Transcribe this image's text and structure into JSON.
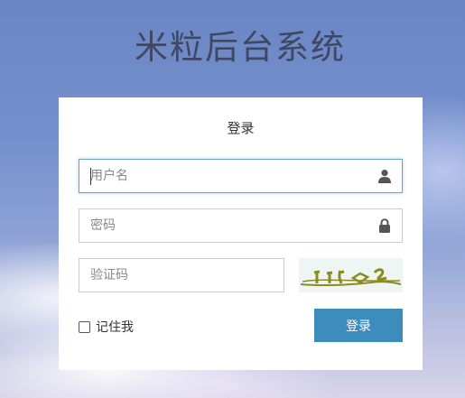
{
  "app": {
    "title": "米粒后台系统"
  },
  "login_form": {
    "heading": "登录",
    "username": {
      "placeholder": "用户名",
      "value": "",
      "icon": "user-icon"
    },
    "password": {
      "placeholder": "密码",
      "value": "",
      "icon": "lock-icon"
    },
    "captcha": {
      "placeholder": "验证码",
      "value": ""
    },
    "captcha_image": {
      "text": "",
      "alt": "captcha"
    },
    "remember_label": "记住我",
    "remember_checked": false,
    "submit_label": "登录"
  },
  "colors": {
    "primary_button": "#3c8dbc",
    "title_text": "#3f4763",
    "focus_border": "#6fa1c8",
    "captcha_ink": "#8a8a1e"
  }
}
